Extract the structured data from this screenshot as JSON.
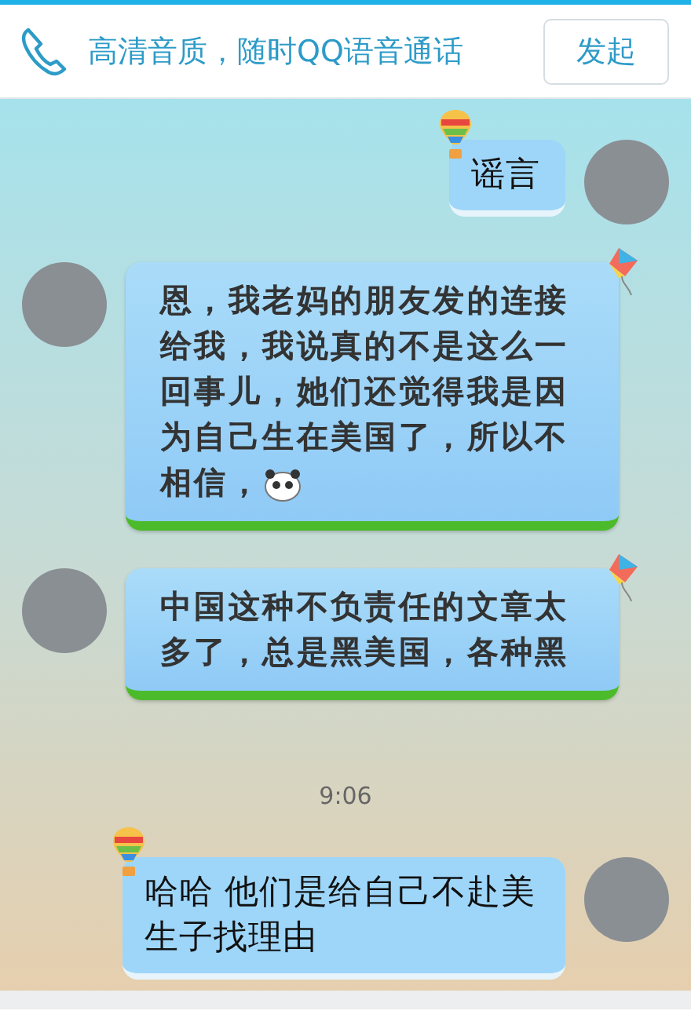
{
  "call_banner": {
    "text": "高清音质，随时QQ语音通话",
    "button": "发起"
  },
  "messages": [
    {
      "kind": "message",
      "sent": true,
      "text": "谣言"
    },
    {
      "kind": "message",
      "sent": false,
      "text": "恩，我老妈的朋友发的连接给我，我说真的不是这么一回事儿，她们还觉得我是因为自己生在美国了，所以不相信，",
      "emoticon": true
    },
    {
      "kind": "message",
      "sent": false,
      "text": "中国这种不负责任的文章太多了，总是黑美国，各种黑",
      "emoticon": false
    },
    {
      "kind": "time",
      "text": "9:06"
    },
    {
      "kind": "message",
      "sent": true,
      "text": "哈哈 他们是给自己不赴美生子找理由"
    }
  ]
}
